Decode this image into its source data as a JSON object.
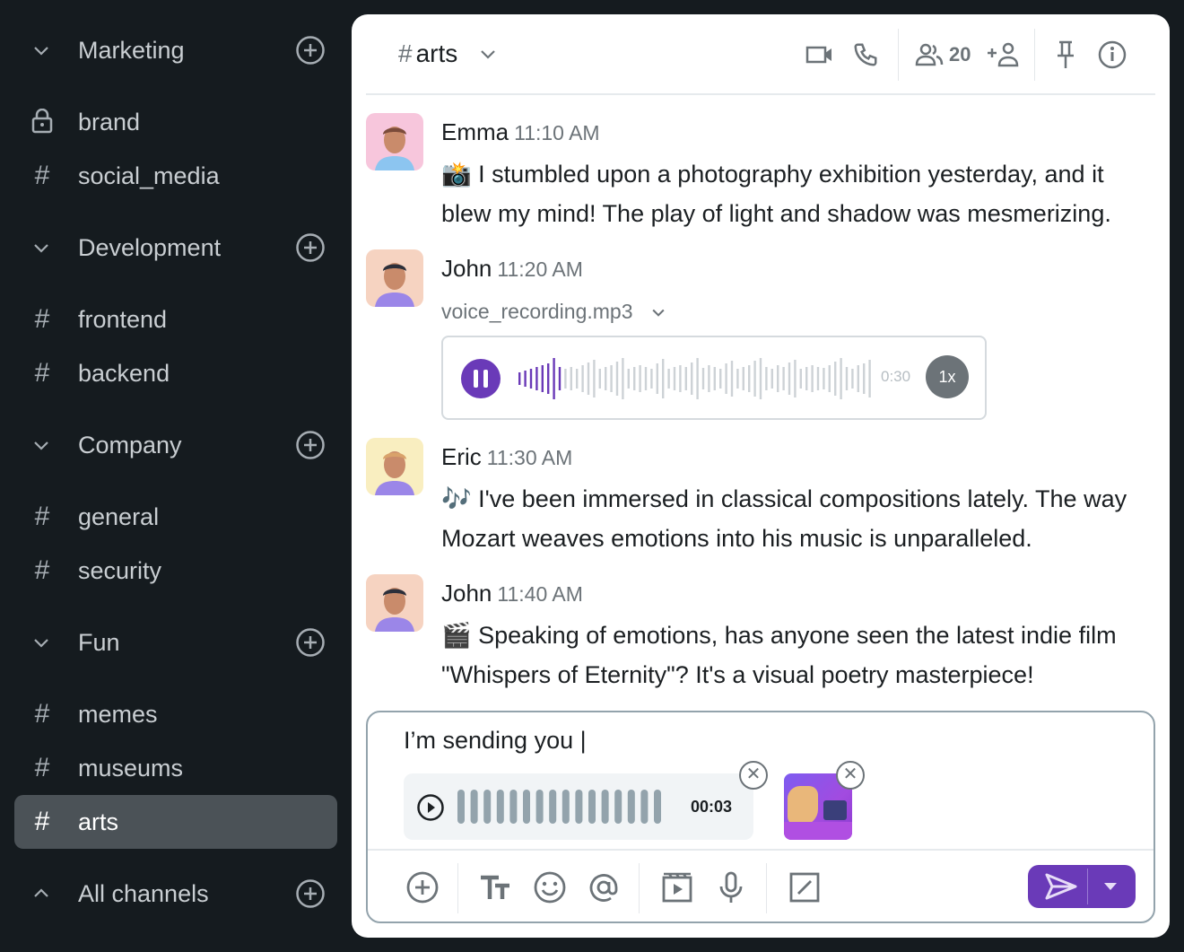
{
  "sidebar": {
    "sections": [
      {
        "label": "Marketing",
        "expanded": true,
        "channels": [
          {
            "name": "brand",
            "icon": "lock-icon"
          },
          {
            "name": "social_media",
            "icon": "hash-icon"
          }
        ]
      },
      {
        "label": "Development",
        "expanded": true,
        "channels": [
          {
            "name": "frontend",
            "icon": "hash-icon"
          },
          {
            "name": "backend",
            "icon": "hash-icon"
          }
        ]
      },
      {
        "label": "Company",
        "expanded": true,
        "channels": [
          {
            "name": "general",
            "icon": "hash-icon"
          },
          {
            "name": "security",
            "icon": "hash-icon"
          }
        ]
      },
      {
        "label": "Fun",
        "expanded": true,
        "channels": [
          {
            "name": "memes",
            "icon": "hash-icon"
          },
          {
            "name": "museums",
            "icon": "hash-icon"
          },
          {
            "name": "arts",
            "icon": "hash-icon",
            "active": true
          }
        ]
      },
      {
        "label": "All channels",
        "expanded": false,
        "channels": []
      }
    ],
    "hash": "#"
  },
  "header": {
    "channel": "arts",
    "hash": "#",
    "members": "20"
  },
  "messages": [
    {
      "author": "Emma",
      "time": "11:10 AM",
      "text": "📸 I stumbled upon a photography exhibition yesterday, and it blew my mind! The play of light and shadow was mesmerizing."
    },
    {
      "author": "John",
      "time": "11:20 AM",
      "file": "voice_recording.mp3",
      "duration": "0:30",
      "speed": "1x",
      "progress": 0.12
    },
    {
      "author": "Eric",
      "time": "11:30 AM",
      "text": "🎶 I've been immersed in classical compositions lately. The way Mozart weaves emotions into his music is unparalleled."
    },
    {
      "author": "John",
      "time": "11:40 AM",
      "text": "🎬 Speaking of emotions, has anyone seen the latest indie film \"Whispers of Eternity\"? It's a visual poetry masterpiece!"
    }
  ],
  "composer": {
    "text": "I’m sending you |",
    "attachment_duration": "00:03"
  },
  "colors": {
    "accent": "#6a3ab8",
    "sidebar_bg": "#151b1f",
    "active_channel": "#4b5257"
  }
}
